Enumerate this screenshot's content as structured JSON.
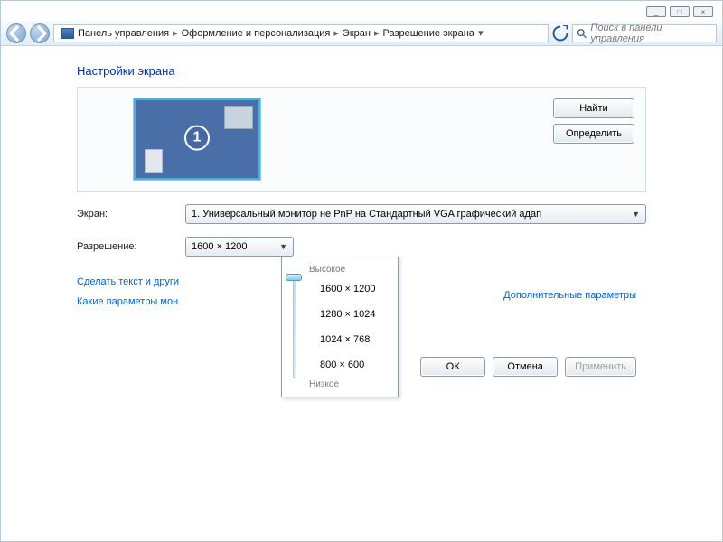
{
  "titlebar": {
    "min": "_",
    "max": "□",
    "close": "×"
  },
  "breadcrumb": {
    "items": [
      "Панель управления",
      "Оформление и персонализация",
      "Экран",
      "Разрешение экрана"
    ]
  },
  "search": {
    "placeholder": "Поиск в панели управления"
  },
  "page_title": "Настройки экрана",
  "preview": {
    "monitor_number": "1",
    "buttons": {
      "find": "Найти",
      "identify": "Определить"
    }
  },
  "form": {
    "screen_label": "Экран:",
    "screen_value": "1. Универсальный монитор не PnP на Стандартный VGA графический адап",
    "resolution_label": "Разрешение:",
    "resolution_value": "1600 × 1200"
  },
  "advanced_link": "Дополнительные параметры",
  "link1": "Сделать текст и други",
  "link2": "Какие параметры мон",
  "buttons": {
    "ok": "ОК",
    "cancel": "Отмена",
    "apply": "Применить"
  },
  "popup": {
    "high": "Высокое",
    "low": "Низкое",
    "options": [
      "1600 × 1200",
      "1280 × 1024",
      "1024 × 768",
      "800 × 600"
    ]
  }
}
